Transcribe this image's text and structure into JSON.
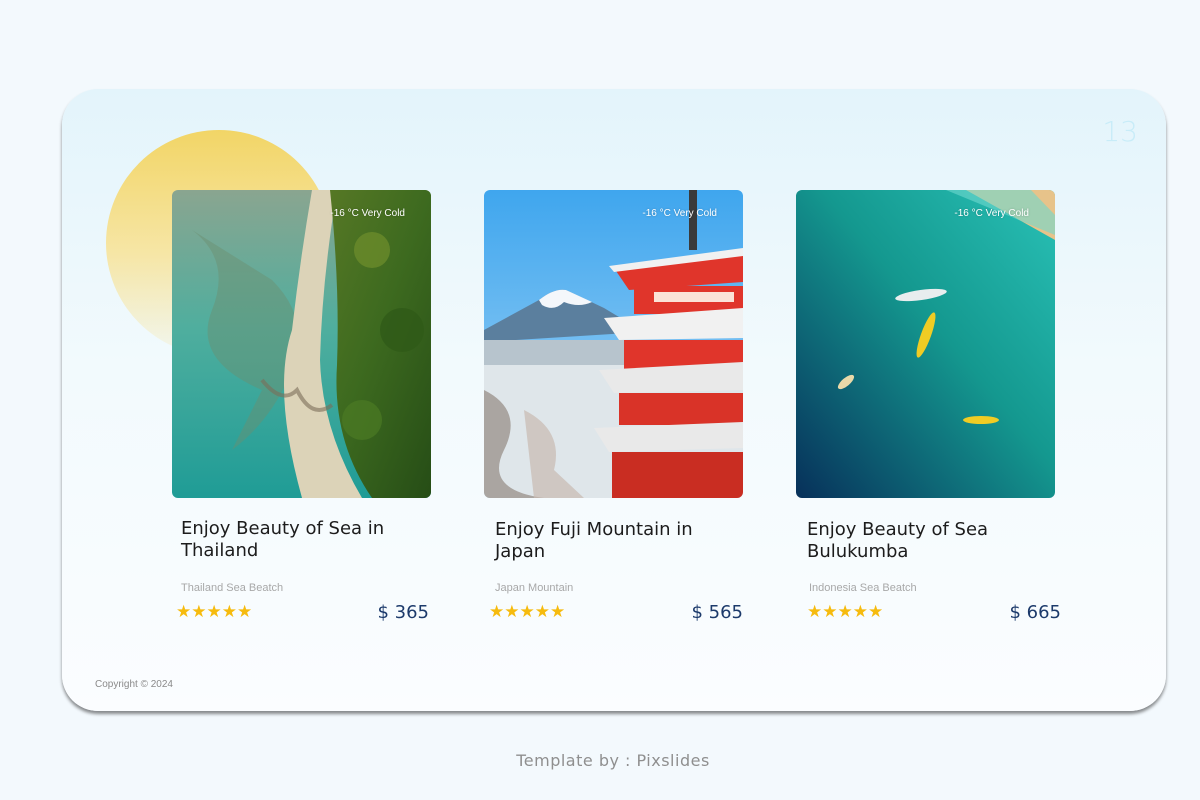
{
  "slide": {
    "page_number": "13",
    "copyright": "Copyright © 2024"
  },
  "footer": {
    "credit": "Template by : Pixslides"
  },
  "cards": [
    {
      "title": "Enjoy Beauty of Sea in Thailand",
      "subtitle": "Thailand Sea Beatch",
      "temperature": "-16 °C Very Cold",
      "rating": 5,
      "stars": "★★★★★",
      "price": "$ 365",
      "image": "aerial-beach-forest-photo"
    },
    {
      "title": "Enjoy Fuji Mountain in Japan",
      "subtitle": "Japan Mountain",
      "temperature": "-16 °C Very Cold",
      "rating": 5,
      "stars": "★★★★★",
      "price": "$ 565",
      "image": "fuji-pagoda-photo"
    },
    {
      "title": "Enjoy Beauty of Sea Bulukumba",
      "subtitle": "Indonesia Sea Beatch",
      "temperature": "-16 °C Very Cold",
      "rating": 5,
      "stars": "★★★★★",
      "price": "$ 665",
      "image": "aerial-sea-boats-photo"
    }
  ],
  "colors": {
    "accent_star": "#f6bb0e",
    "price": "#1c3a6b",
    "sun": "#f2d566"
  }
}
